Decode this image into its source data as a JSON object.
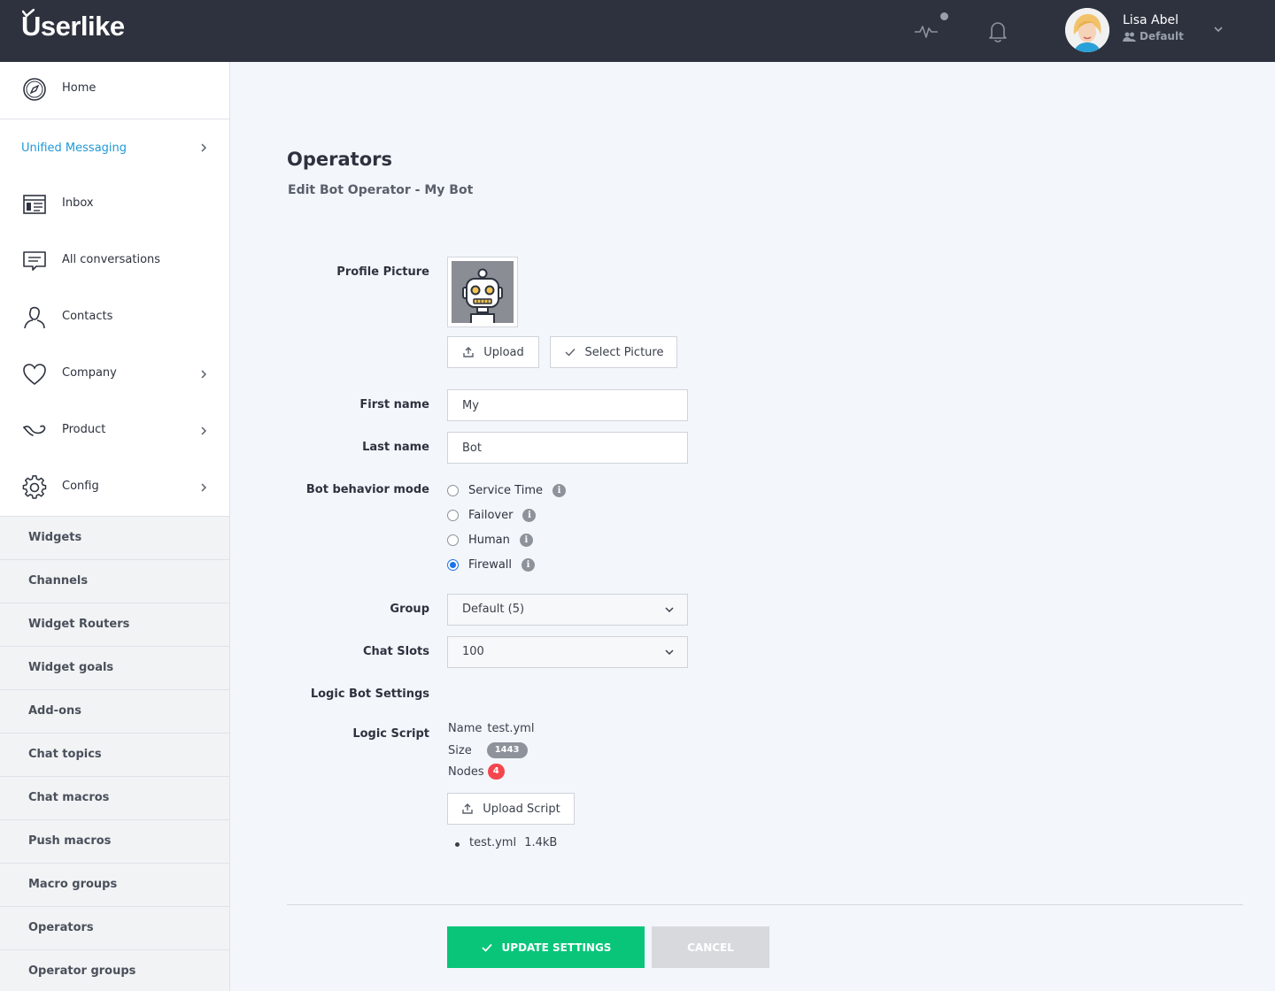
{
  "app": {
    "logo": "Userlike",
    "user": {
      "name": "Lisa Abel",
      "role": "Default"
    }
  },
  "sidebar": {
    "home": "Home",
    "unified_messaging": "Unified Messaging",
    "items": [
      {
        "label": "Inbox",
        "icon": "inbox-icon"
      },
      {
        "label": "All conversations",
        "icon": "chat-bubble-icon"
      },
      {
        "label": "Contacts",
        "icon": "person-icon"
      },
      {
        "label": "Company",
        "icon": "heart-icon"
      },
      {
        "label": "Product",
        "icon": "product-icon"
      },
      {
        "label": "Config",
        "icon": "gear-icon"
      }
    ],
    "sub_items": [
      "Widgets",
      "Channels",
      "Widget Routers",
      "Widget goals",
      "Add-ons",
      "Chat topics",
      "Chat macros",
      "Push macros",
      "Macro groups",
      "Operators",
      "Operator groups"
    ]
  },
  "main": {
    "title": "Operators",
    "subtitle": "Edit Bot Operator - My Bot",
    "labels": {
      "profile_picture": "Profile Picture",
      "first_name": "First name",
      "last_name": "Last name",
      "bot_behavior_mode": "Bot behavior mode",
      "group": "Group",
      "chat_slots": "Chat Slots",
      "logic_bot_settings": "Logic Bot Settings",
      "logic_script": "Logic Script"
    },
    "upload_label": "Upload",
    "select_picture_label": "Select Picture",
    "first_name": "My",
    "last_name": "Bot",
    "behavior_modes": [
      {
        "label": "Service Time",
        "selected": false
      },
      {
        "label": "Failover",
        "selected": false
      },
      {
        "label": "Human",
        "selected": false
      },
      {
        "label": "Firewall",
        "selected": true
      }
    ],
    "group_value": "Default (5)",
    "chat_slots_value": "100",
    "script": {
      "name_label": "Name",
      "name": "test.yml",
      "size_label": "Size",
      "size": "1443",
      "nodes_label": "Nodes",
      "nodes": "4",
      "upload_label": "Upload Script",
      "file_name": "test.yml",
      "file_size": "1.4kB"
    },
    "update_label": "UPDATE SETTINGS",
    "cancel_label": "CANCEL"
  },
  "colors": {
    "topbar": "#2d323e",
    "accent_blue": "#1f99d6",
    "primary_green": "#08c57a",
    "badge_red": "#f4464e"
  }
}
